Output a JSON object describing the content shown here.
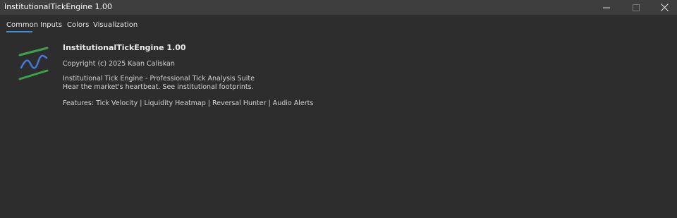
{
  "window": {
    "title": "InstitutionalTickEngine 1.00",
    "controls": {
      "minimize_icon": "minimize-icon",
      "maximize_icon": "maximize-icon",
      "close_icon": "close-icon"
    }
  },
  "tabs": [
    {
      "label": "Common",
      "active": true
    },
    {
      "label": "Inputs",
      "active": false
    },
    {
      "label": "Colors",
      "active": false
    },
    {
      "label": "Visualization",
      "active": false
    }
  ],
  "common": {
    "logo_icon": "indicator-wave-logo",
    "app_name": "InstitutionalTickEngine 1.00",
    "copyright": "Copyright (c) 2025 Kaan Caliskan",
    "description_line1": "Institutional Tick Engine - Professional Tick Analysis Suite",
    "description_line2": "Hear the market's heartbeat. See institutional footprints.",
    "features": "Features: Tick Velocity | Liquidity Heatmap | Reversal Hunter | Audio Alerts"
  },
  "colors": {
    "background": "#2d2d2d",
    "titlebar": "#3e3e3e",
    "accent": "#3b8fd6",
    "logo_green": "#3aa34a",
    "logo_blue": "#3f6fd1"
  }
}
